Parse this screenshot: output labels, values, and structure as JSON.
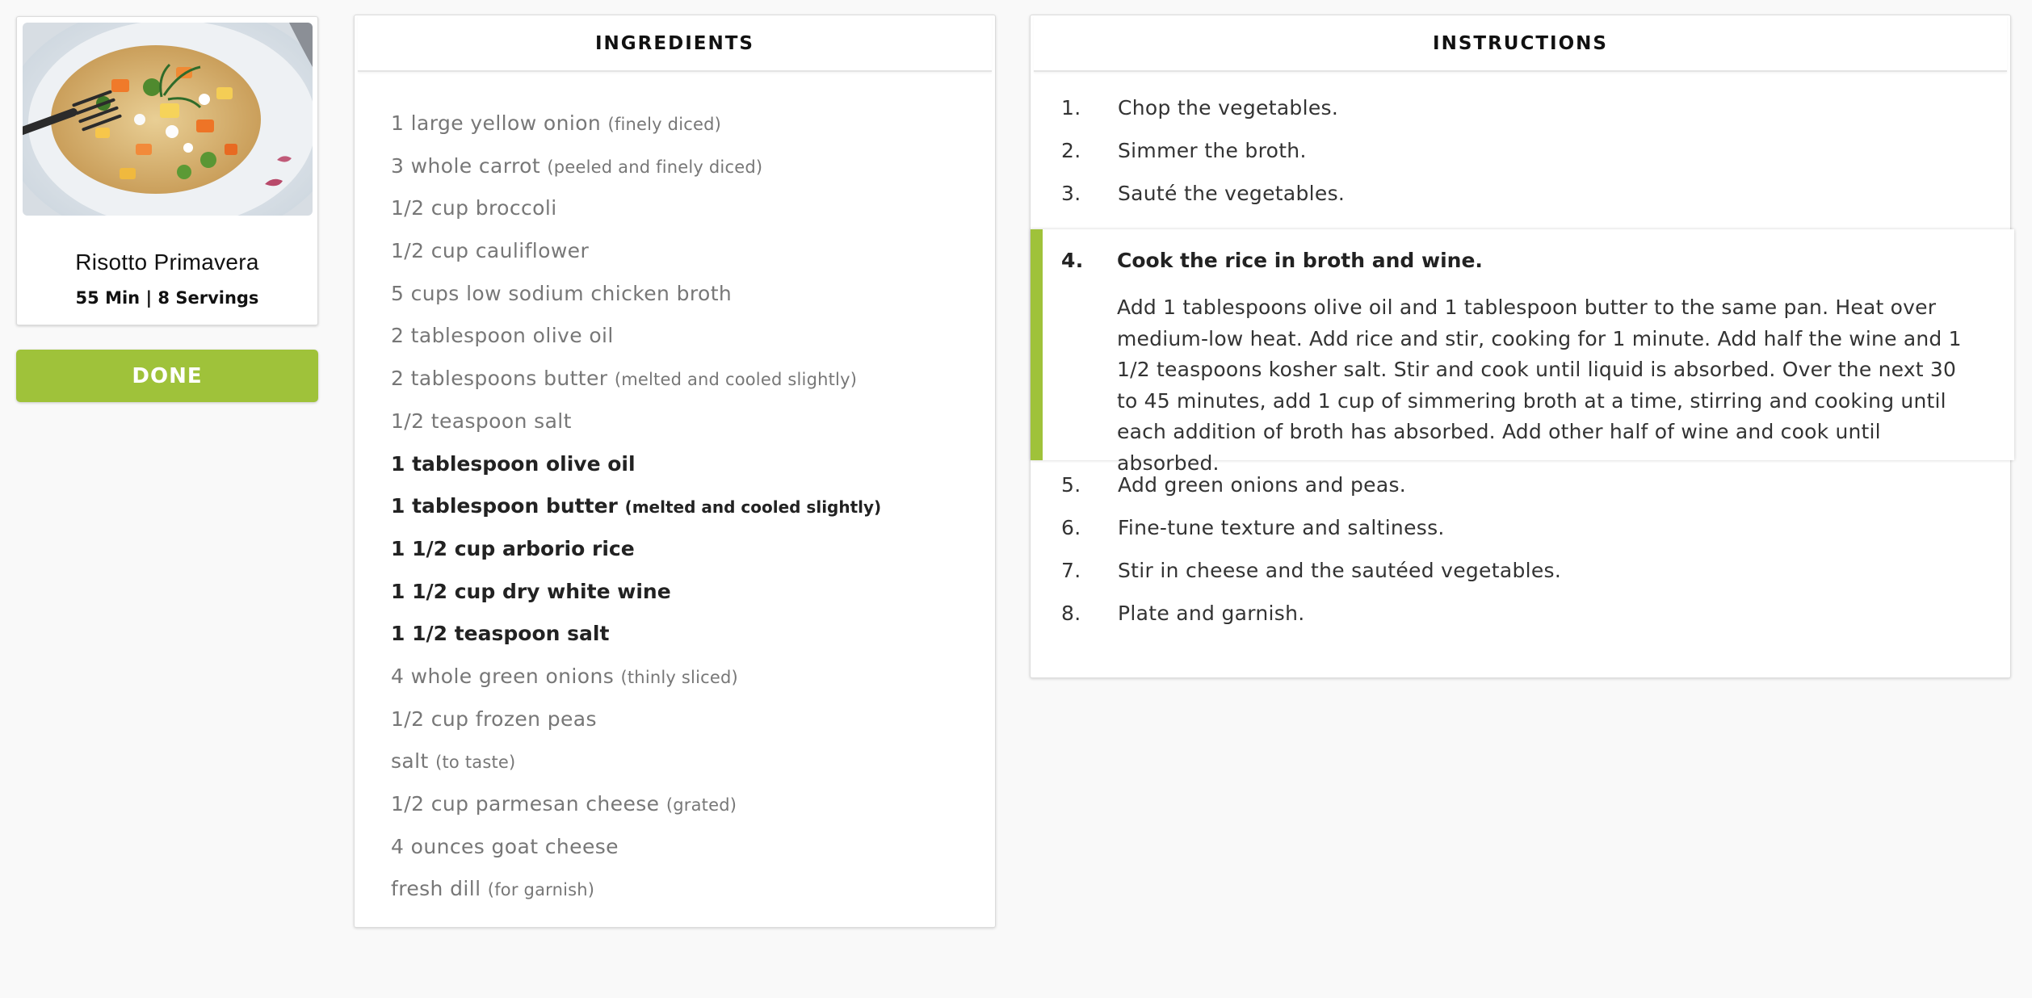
{
  "recipe": {
    "title": "Risotto Primavera",
    "meta": "55 Min | 8 Servings",
    "photo_icon": "risotto-photo"
  },
  "done_label": "DONE",
  "ingredients": {
    "header": "INGREDIENTS",
    "items": [
      {
        "text": "1 large yellow onion",
        "note": "(finely diced)",
        "active": false
      },
      {
        "text": "3 whole carrot",
        "note": "(peeled and finely diced)",
        "active": false
      },
      {
        "text": "1/2 cup broccoli",
        "note": "",
        "active": false
      },
      {
        "text": "1/2 cup cauliflower",
        "note": "",
        "active": false
      },
      {
        "text": "5 cups low sodium chicken broth",
        "note": "",
        "active": false
      },
      {
        "text": "2 tablespoon olive oil",
        "note": "",
        "active": false
      },
      {
        "text": "2 tablespoons butter",
        "note": "(melted and cooled slightly)",
        "active": false
      },
      {
        "text": "1/2 teaspoon salt",
        "note": "",
        "active": false
      },
      {
        "text": "1 tablespoon olive oil",
        "note": "",
        "active": true
      },
      {
        "text": "1 tablespoon butter",
        "note": "(melted and cooled slightly)",
        "active": true
      },
      {
        "text": "1 1/2 cup arborio rice",
        "note": "",
        "active": true
      },
      {
        "text": "1 1/2 cup dry white wine",
        "note": "",
        "active": true
      },
      {
        "text": "1 1/2 teaspoon salt",
        "note": "",
        "active": true
      },
      {
        "text": "4 whole green onions",
        "note": "(thinly sliced)",
        "active": false
      },
      {
        "text": "1/2 cup frozen peas",
        "note": "",
        "active": false
      },
      {
        "text": "salt",
        "note": "(to taste)",
        "active": false
      },
      {
        "text": "1/2 cup parmesan cheese",
        "note": "(grated)",
        "active": false
      },
      {
        "text": "4 ounces goat cheese",
        "note": "",
        "active": false
      },
      {
        "text": "fresh dill",
        "note": "(for garnish)",
        "active": false
      }
    ]
  },
  "instructions": {
    "header": "INSTRUCTIONS",
    "steps": [
      {
        "num": "1.",
        "text": "Chop the vegetables.",
        "active": false,
        "detail": ""
      },
      {
        "num": "2.",
        "text": "Simmer the broth.",
        "active": false,
        "detail": ""
      },
      {
        "num": "3.",
        "text": "Sauté the vegetables.",
        "active": false,
        "detail": ""
      },
      {
        "num": "4.",
        "text": "Cook the rice in broth and wine.",
        "active": true,
        "detail": "Add 1 tablespoons olive oil and 1 tablespoon butter to the same pan. Heat over medium-low heat. Add rice and stir, cooking for 1 minute. Add half the wine and 1 1/2 teaspoons kosher salt. Stir and cook until liquid is absorbed. Over the next 30 to 45 minutes, add 1 cup of simmering broth at a time, stirring and cooking until each addition of broth has absorbed. Add other half of wine and cook until absorbed."
      },
      {
        "num": "5.",
        "text": "Add green onions and peas.",
        "active": false,
        "detail": ""
      },
      {
        "num": "6.",
        "text": "Fine-tune texture and saltiness.",
        "active": false,
        "detail": ""
      },
      {
        "num": "7.",
        "text": "Stir in cheese and the sautéed vegetables.",
        "active": false,
        "detail": ""
      },
      {
        "num": "8.",
        "text": "Plate and garnish.",
        "active": false,
        "detail": ""
      }
    ]
  },
  "colors": {
    "accent": "#9fc23a",
    "muted_text": "#777777",
    "strong_text": "#222222"
  }
}
